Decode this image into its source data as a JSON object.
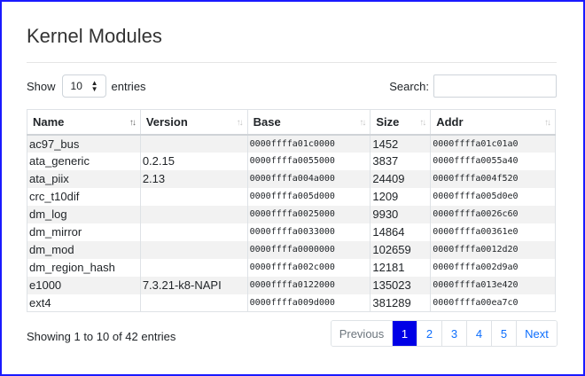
{
  "page": {
    "title": "Kernel Modules"
  },
  "length": {
    "show_label": "Show",
    "value": "10",
    "entries_label": "entries"
  },
  "search": {
    "label": "Search:",
    "value": ""
  },
  "table": {
    "columns": [
      "Name",
      "Version",
      "Base",
      "Size",
      "Addr"
    ],
    "rows": [
      [
        "ac97_bus",
        "",
        "0000ffffa01c0000",
        "1452",
        "0000ffffa01c01a0"
      ],
      [
        "ata_generic",
        "0.2.15",
        "0000ffffa0055000",
        "3837",
        "0000ffffa0055a40"
      ],
      [
        "ata_piix",
        "2.13",
        "0000ffffa004a000",
        "24409",
        "0000ffffa004f520"
      ],
      [
        "crc_t10dif",
        "",
        "0000ffffa005d000",
        "1209",
        "0000ffffa005d0e0"
      ],
      [
        "dm_log",
        "",
        "0000ffffa0025000",
        "9930",
        "0000ffffa0026c60"
      ],
      [
        "dm_mirror",
        "",
        "0000ffffa0033000",
        "14864",
        "0000ffffa00361e0"
      ],
      [
        "dm_mod",
        "",
        "0000ffffa0000000",
        "102659",
        "0000ffffa0012d20"
      ],
      [
        "dm_region_hash",
        "",
        "0000ffffa002c000",
        "12181",
        "0000ffffa002d9a0"
      ],
      [
        "e1000",
        "7.3.21-k8-NAPI",
        "0000ffffa0122000",
        "135023",
        "0000ffffa013e420"
      ],
      [
        "ext4",
        "",
        "0000ffffa009d000",
        "381289",
        "0000ffffa00ea7c0"
      ]
    ]
  },
  "footer": {
    "info": "Showing 1 to 10 of 42 entries",
    "previous": "Previous",
    "next": "Next",
    "pages": [
      "1",
      "2",
      "3",
      "4",
      "5"
    ],
    "active_page": "1"
  }
}
